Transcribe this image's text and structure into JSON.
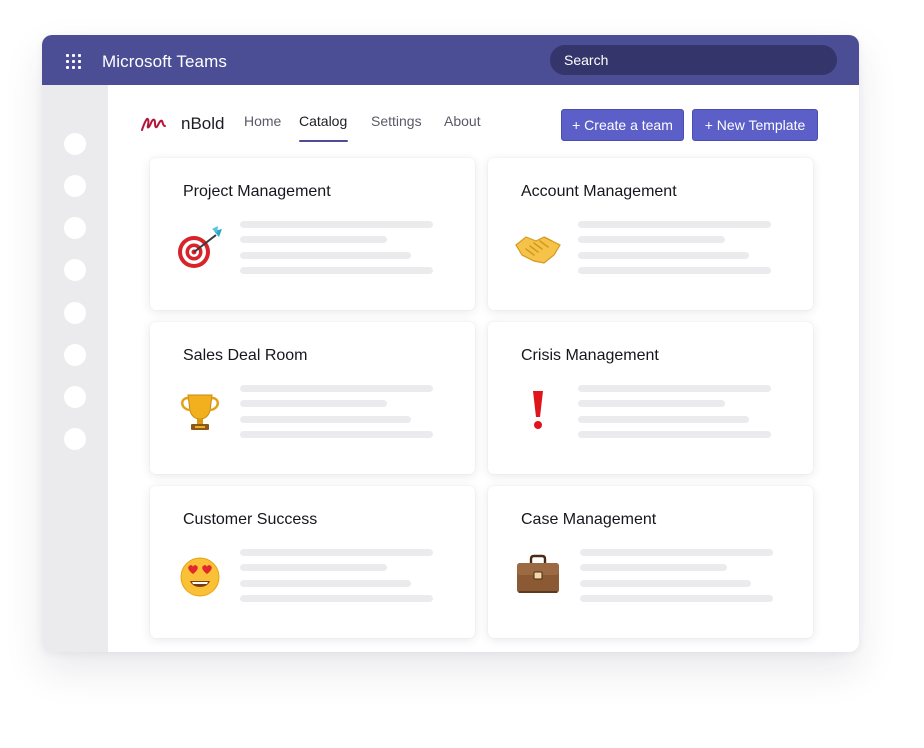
{
  "app": {
    "title": "Microsoft Teams",
    "search_placeholder": "Search"
  },
  "brand": {
    "name": "nBold"
  },
  "nav": {
    "items": [
      {
        "label": "Home",
        "active": false
      },
      {
        "label": "Catalog",
        "active": true
      },
      {
        "label": "Settings",
        "active": false
      },
      {
        "label": "About",
        "active": false
      }
    ]
  },
  "actions": {
    "create_team": "+ Create a team",
    "new_template": "+ New Template"
  },
  "cards": [
    {
      "title": "Project Management",
      "icon": "target-icon"
    },
    {
      "title": "Account Management",
      "icon": "handshake-icon"
    },
    {
      "title": "Sales Deal Room",
      "icon": "trophy-icon"
    },
    {
      "title": "Crisis Management",
      "icon": "exclamation-icon"
    },
    {
      "title": "Customer Success",
      "icon": "heart-eyes-icon"
    },
    {
      "title": "Case Management",
      "icon": "briefcase-icon"
    }
  ],
  "colors": {
    "header": "#4b4e94",
    "search": "#33356b",
    "accent": "#5b5fc7",
    "rail": "#ebebee"
  }
}
